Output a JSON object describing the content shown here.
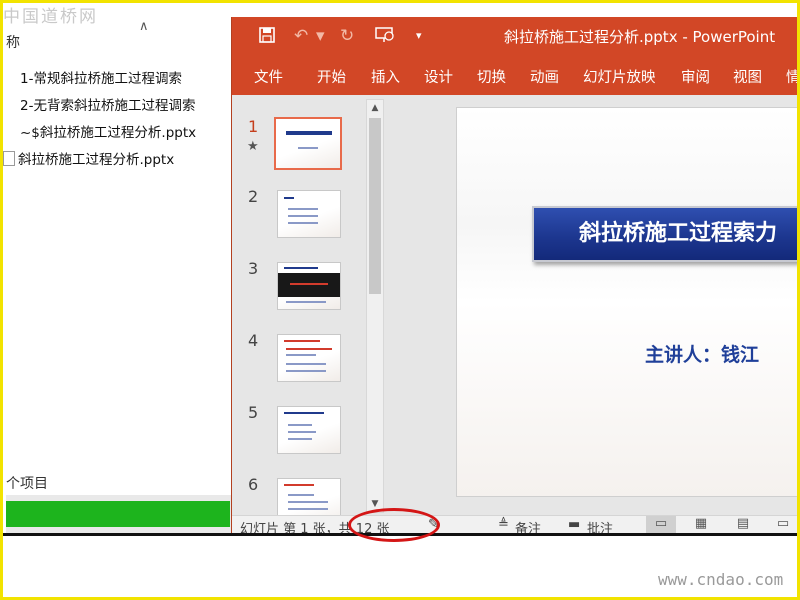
{
  "explorer": {
    "column_header": "称",
    "files": [
      {
        "name": "1-常规斜拉桥施工过程调索"
      },
      {
        "name": "2-无背索斜拉桥施工过程调索"
      },
      {
        "name": "~$斜拉桥施工过程分析.pptx"
      },
      {
        "name": "斜拉桥施工过程分析.pptx"
      }
    ],
    "item_count": "个项目"
  },
  "ppt": {
    "doc_title": "斜拉桥施工过程分析.pptx  -  PowerPoint",
    "quick_access": [
      "save-icon",
      "undo-icon",
      "redo-icon",
      "present-from-start-icon",
      "customize-dropdown-icon"
    ],
    "tabs": [
      "文件",
      "开始",
      "插入",
      "设计",
      "切换",
      "动画",
      "幻灯片放映",
      "审阅",
      "视图",
      "情"
    ],
    "slide_numbers": [
      "1",
      "2",
      "3",
      "4",
      "5",
      "6"
    ],
    "current_slide": {
      "title": "斜拉桥施工过程索力",
      "presenter": "主讲人：钱江"
    },
    "status": {
      "slide_info": "幻灯片 第 1 张，共 12 张",
      "notes_label": "备注",
      "comments_label": "批注"
    }
  },
  "watermarks": {
    "top": "中国道桥网",
    "bottom": "www.cndao.com"
  },
  "colors": {
    "ppt_accent": "#d24726",
    "title_box": "#1d3790",
    "presenter_text": "#1f3f99",
    "annotation_circle": "#d41616",
    "progress_green": "#1db41d"
  }
}
